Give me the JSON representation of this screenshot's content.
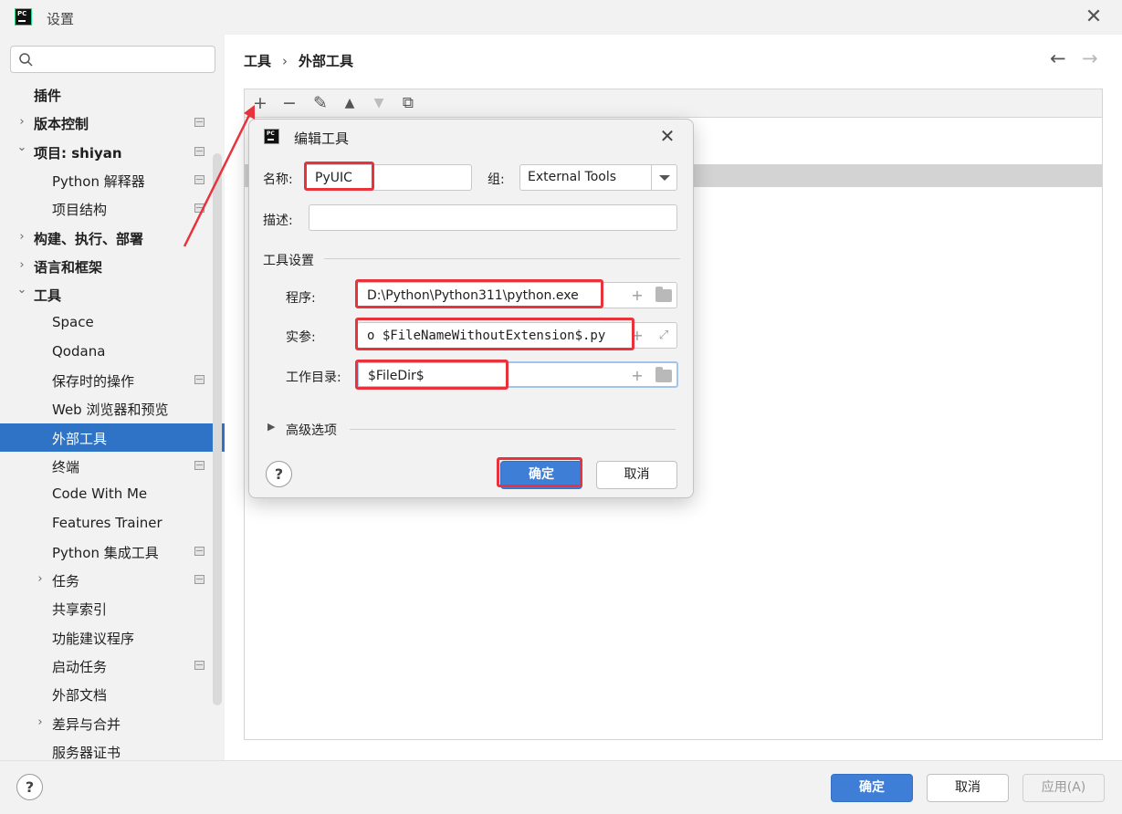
{
  "window": {
    "title": "设置",
    "logo_text": "PC"
  },
  "search": {
    "placeholder": ""
  },
  "sidebar": {
    "items": [
      {
        "label": "插件",
        "bold": true,
        "expander": "",
        "project": false,
        "selected": false
      },
      {
        "label": "版本控制",
        "bold": true,
        "expander": "›",
        "project": true,
        "selected": false
      },
      {
        "label": "项目: shiyan",
        "bold": true,
        "expander": "⌄",
        "project": true,
        "selected": false
      },
      {
        "label": "Python 解释器",
        "bold": false,
        "expander": "",
        "project": true,
        "selected": false
      },
      {
        "label": "项目结构",
        "bold": false,
        "expander": "",
        "project": true,
        "selected": false
      },
      {
        "label": "构建、执行、部署",
        "bold": true,
        "expander": "›",
        "project": false,
        "selected": false
      },
      {
        "label": "语言和框架",
        "bold": true,
        "expander": "›",
        "project": false,
        "selected": false
      },
      {
        "label": "工具",
        "bold": true,
        "expander": "⌄",
        "project": false,
        "selected": false
      },
      {
        "label": "Space",
        "bold": false,
        "expander": "",
        "project": false,
        "selected": false
      },
      {
        "label": "Qodana",
        "bold": false,
        "expander": "",
        "project": false,
        "selected": false
      },
      {
        "label": "保存时的操作",
        "bold": false,
        "expander": "",
        "project": true,
        "selected": false
      },
      {
        "label": "Web 浏览器和预览",
        "bold": false,
        "expander": "",
        "project": false,
        "selected": false
      },
      {
        "label": "外部工具",
        "bold": false,
        "expander": "",
        "project": false,
        "selected": true
      },
      {
        "label": "终端",
        "bold": false,
        "expander": "",
        "project": true,
        "selected": false
      },
      {
        "label": "Code With Me",
        "bold": false,
        "expander": "",
        "project": false,
        "selected": false
      },
      {
        "label": "Features Trainer",
        "bold": false,
        "expander": "",
        "project": false,
        "selected": false
      },
      {
        "label": "Python 集成工具",
        "bold": false,
        "expander": "",
        "project": true,
        "selected": false
      },
      {
        "label": "任务",
        "bold": false,
        "expander": "›",
        "project": true,
        "selected": false
      },
      {
        "label": "共享索引",
        "bold": false,
        "expander": "",
        "project": false,
        "selected": false
      },
      {
        "label": "功能建议程序",
        "bold": false,
        "expander": "",
        "project": false,
        "selected": false
      },
      {
        "label": "启动任务",
        "bold": false,
        "expander": "",
        "project": true,
        "selected": false
      },
      {
        "label": "外部文档",
        "bold": false,
        "expander": "",
        "project": false,
        "selected": false
      },
      {
        "label": "差异与合并",
        "bold": false,
        "expander": "›",
        "project": false,
        "selected": false
      },
      {
        "label": "服务器证书",
        "bold": false,
        "expander": "",
        "project": false,
        "selected": false
      }
    ]
  },
  "breadcrumb": {
    "parent": "工具",
    "separator": "›",
    "current": "外部工具"
  },
  "toolbar": {
    "add": "+",
    "remove": "−",
    "edit": "✎",
    "move_up": "▲",
    "move_down": "▼",
    "copy": "⧉"
  },
  "dialog": {
    "title": "编辑工具",
    "name_label": "名称:",
    "name_value": "PyUIC",
    "group_label": "组:",
    "group_value": "External Tools",
    "description_label": "描述:",
    "description_value": "",
    "tool_settings_title": "工具设置",
    "program_label": "程序:",
    "program_value": "D:\\Python\\Python311\\python.exe",
    "arguments_label": "实参:",
    "arguments_value": "o $FileNameWithoutExtension$.py",
    "workdir_label": "工作目录:",
    "workdir_value": "$FileDir$",
    "advanced_label": "高级选项",
    "ok_label": "确定",
    "cancel_label": "取消",
    "help_label": "?"
  },
  "footer": {
    "help_label": "?",
    "ok_label": "确定",
    "cancel_label": "取消",
    "apply_label": "应用(A)"
  },
  "colors": {
    "selection": "#2e73c6",
    "primary_button": "#3e7ed6",
    "highlight_annotation": "#e8323c"
  }
}
